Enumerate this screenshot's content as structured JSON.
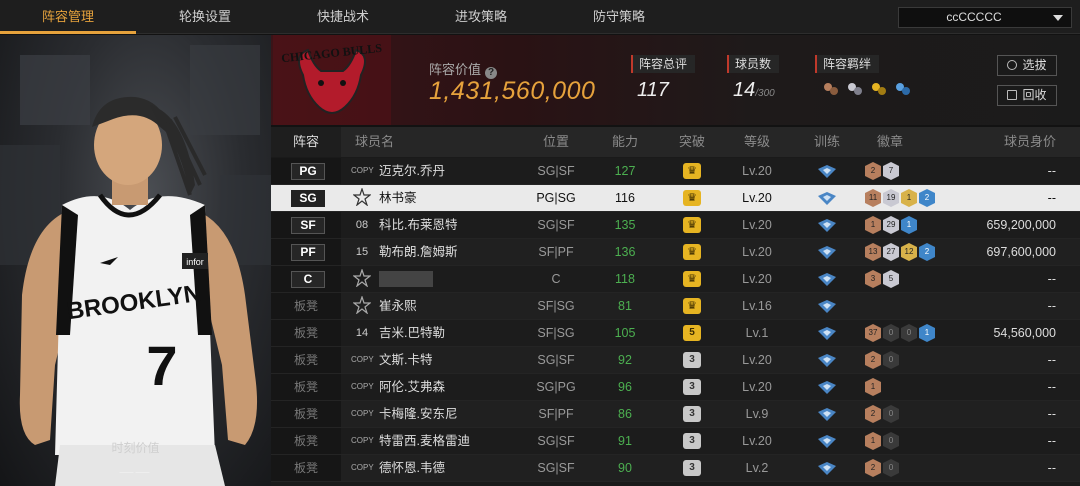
{
  "nav": {
    "tabs": [
      "阵容管理",
      "轮换设置",
      "快捷战术",
      "进攻策略",
      "防守策略"
    ],
    "active_tab": "阵容管理",
    "team_select": "ccCCCCC"
  },
  "left_panel": {
    "caption": "时刻价值",
    "value": "——"
  },
  "header": {
    "team_logo_text": "CHICAGO BULLS",
    "lineup_value_label": "阵容价值",
    "lineup_value": "1,431,560,000",
    "rating_label": "阵容总评",
    "rating_value": "117",
    "player_count_label": "球员数",
    "player_count": "14",
    "player_count_max": "/300",
    "bond_label": "阵容羁绊",
    "buttons": {
      "draft": "选拔",
      "recycle": "回收"
    }
  },
  "table": {
    "headers": [
      "阵容",
      "球员名",
      "位置",
      "能力",
      "突破",
      "等级",
      "训练",
      "徽章",
      "球员身价"
    ],
    "rows": [
      {
        "slot": "PG",
        "avatar": "COPY",
        "name": "迈克尔.乔丹",
        "pos": "SG|SF",
        "power": "127",
        "breakthrough": "",
        "level": "Lv.20",
        "badges": [
          [
            "bronze",
            "2"
          ],
          [
            "silver",
            "7"
          ]
        ],
        "value": "--"
      },
      {
        "slot": "SG",
        "avatar": "",
        "name": "林书豪",
        "pos": "PG|SG",
        "power": "116",
        "breakthrough": "",
        "level": "Lv.20",
        "badges": [
          [
            "bronze",
            "11"
          ],
          [
            "silver",
            "19"
          ],
          [
            "gold",
            "1"
          ],
          [
            "blue",
            "2"
          ]
        ],
        "value": "--",
        "selected": true
      },
      {
        "slot": "SF",
        "avatar": "08",
        "name": "科比.布莱恩特",
        "pos": "SG|SF",
        "power": "135",
        "breakthrough": "",
        "level": "Lv.20",
        "badges": [
          [
            "bronze",
            "1"
          ],
          [
            "silver",
            "29"
          ],
          [
            "blue",
            "1"
          ]
        ],
        "value": "659,200,000"
      },
      {
        "slot": "PF",
        "avatar": "15",
        "name": "勒布朗.詹姆斯",
        "pos": "SF|PF",
        "power": "136",
        "breakthrough": "",
        "level": "Lv.20",
        "badges": [
          [
            "bronze",
            "13"
          ],
          [
            "silver",
            "27"
          ],
          [
            "gold",
            "12"
          ],
          [
            "blue",
            "2"
          ]
        ],
        "value": "697,600,000"
      },
      {
        "slot": "C",
        "avatar": "",
        "name": "",
        "pos": "C",
        "power": "118",
        "breakthrough": "",
        "level": "Lv.20",
        "badges": [
          [
            "bronze",
            "3"
          ],
          [
            "silver",
            "5"
          ]
        ],
        "value": "--"
      },
      {
        "slot": "板凳",
        "avatar": "",
        "name": "崔永熙",
        "pos": "SF|SG",
        "power": "81",
        "breakthrough": "",
        "level": "Lv.16",
        "badges": [],
        "value": "--"
      },
      {
        "slot": "板凳",
        "avatar": "14",
        "name": "吉米.巴特勒",
        "pos": "SF|SG",
        "power": "105",
        "breakthrough": "5",
        "level": "Lv.1",
        "badges": [
          [
            "bronze",
            "37"
          ],
          [
            "dark",
            "0"
          ],
          [
            "dark",
            "0"
          ],
          [
            "blue",
            "1"
          ]
        ],
        "value": "54,560,000"
      },
      {
        "slot": "板凳",
        "avatar": "COPY",
        "name": "文斯.卡特",
        "pos": "SG|SF",
        "power": "92",
        "breakthrough": "3",
        "level": "Lv.20",
        "badges": [
          [
            "bronze",
            "2"
          ],
          [
            "dark",
            "0"
          ]
        ],
        "value": "--"
      },
      {
        "slot": "板凳",
        "avatar": "COPY",
        "name": "阿伦.艾弗森",
        "pos": "SG|PG",
        "power": "96",
        "breakthrough": "3",
        "level": "Lv.20",
        "badges": [
          [
            "bronze",
            "1"
          ]
        ],
        "value": "--"
      },
      {
        "slot": "板凳",
        "avatar": "COPY",
        "name": "卡梅隆.安东尼",
        "pos": "SF|PF",
        "power": "86",
        "breakthrough": "3",
        "level": "Lv.9",
        "badges": [
          [
            "bronze",
            "2"
          ],
          [
            "dark",
            "0"
          ]
        ],
        "value": "--"
      },
      {
        "slot": "板凳",
        "avatar": "COPY",
        "name": "特雷西.麦格雷迪",
        "pos": "SG|SF",
        "power": "91",
        "breakthrough": "3",
        "level": "Lv.20",
        "badges": [
          [
            "bronze",
            "1"
          ],
          [
            "dark",
            "0"
          ]
        ],
        "value": "--"
      },
      {
        "slot": "板凳",
        "avatar": "COPY",
        "name": "德怀恩.韦德",
        "pos": "SG|SF",
        "power": "90",
        "breakthrough": "3",
        "level": "Lv.2",
        "badges": [
          [
            "bronze",
            "2"
          ],
          [
            "dark",
            "0"
          ]
        ],
        "value": "--"
      }
    ]
  },
  "jersey": {
    "team": "BROOKLYN",
    "number": "7",
    "sponsor": "infor"
  },
  "colors": {
    "accent": "#e6a23c",
    "power_green": "#4caf50",
    "rating_red": "#c0392b"
  }
}
